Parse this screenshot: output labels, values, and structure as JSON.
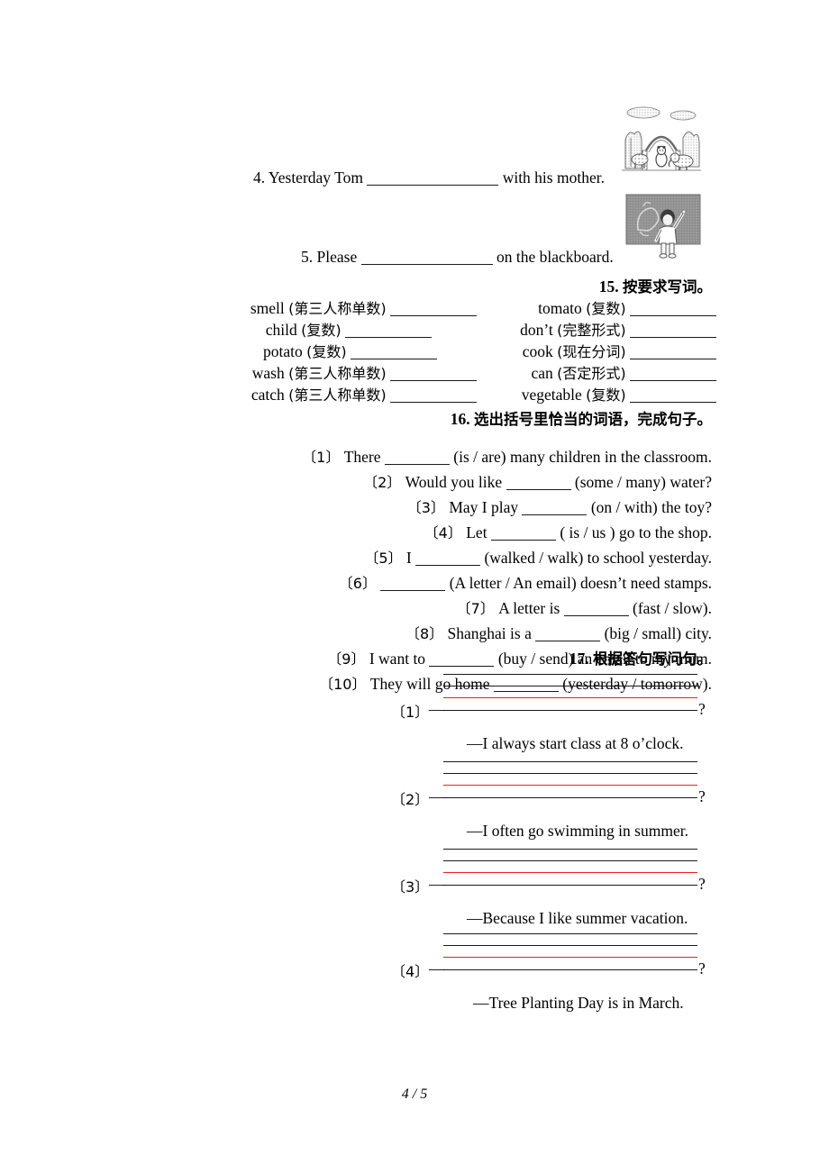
{
  "page": {
    "footer": "4 / 5"
  },
  "top_sentences": [
    {
      "number": "4.",
      "before": "Yesterday Tom",
      "after": "with his mother.",
      "image": "zoo-park-scene-clipart"
    },
    {
      "number": "5.",
      "before": "Please",
      "after": "on the blackboard.",
      "image": "child-drawing-blackboard-clipart"
    }
  ],
  "section15": {
    "number": "15.",
    "title": "按要求写词。",
    "left_column": [
      {
        "word": "smell",
        "hint": "(第三人称单数)"
      },
      {
        "word": "child",
        "hint": "(复数)"
      },
      {
        "word": "potato",
        "hint": "(复数)"
      },
      {
        "word": "wash",
        "hint": "(第三人称单数)"
      },
      {
        "word": "catch",
        "hint": "(第三人称单数)"
      }
    ],
    "right_column": [
      {
        "word": "tomato",
        "hint": "(复数)"
      },
      {
        "word": "don’t",
        "hint": "(完整形式)"
      },
      {
        "word": "cook",
        "hint": "(现在分词)"
      },
      {
        "word": "can",
        "hint": "(否定形式)"
      },
      {
        "word": "vegetable",
        "hint": "(复数)"
      }
    ]
  },
  "section16": {
    "number": "16.",
    "title": "选出括号里恰当的词语，完成句子。",
    "items": [
      {
        "num": "〔1〕",
        "before": "There",
        "after": "(is / are) many children in the classroom."
      },
      {
        "num": "〔2〕",
        "before": "Would you like",
        "after": "(some / many) water?"
      },
      {
        "num": "〔3〕",
        "before": "May I play",
        "after": "(on / with) the toy?"
      },
      {
        "num": "〔4〕",
        "before": "Let",
        "after": "( is / us ) go to the shop."
      },
      {
        "num": "〔5〕",
        "before": "I",
        "after": "(walked / walk) to school yesterday."
      },
      {
        "num": "〔6〕",
        "before": "",
        "after": "(A letter / An email) doesn’t need stamps."
      },
      {
        "num": "〔7〕",
        "before": "A letter is",
        "after": "(fast / slow)."
      },
      {
        "num": "〔8〕",
        "before": "Shanghai is a",
        "after": "(big / small) city."
      },
      {
        "num": "〔9〕",
        "before": "I want to",
        "after": "(buy / send) an email to my mum."
      },
      {
        "num": "〔10〕",
        "before": "They will go home",
        "after": "(yesterday / tomorrow)."
      }
    ]
  },
  "section17": {
    "number": "17.",
    "title": "根据答句写问句。",
    "items": [
      {
        "num": "〔1〕",
        "dash": "—",
        "qmark": "?",
        "answer": "—I always start class at 8 o’clock."
      },
      {
        "num": "〔2〕",
        "dash": "—",
        "qmark": "?",
        "answer": "—I often go swimming in summer."
      },
      {
        "num": "〔3〕",
        "dash": "—",
        "qmark": "?",
        "answer": "—Because I like summer vacation."
      },
      {
        "num": "〔4〕",
        "dash": "—",
        "qmark": "?",
        "answer": "—Tree Planting Day is in March."
      }
    ]
  },
  "colors": {
    "rule_black": "#1a1a1a",
    "rule_red": "#e8201a"
  }
}
